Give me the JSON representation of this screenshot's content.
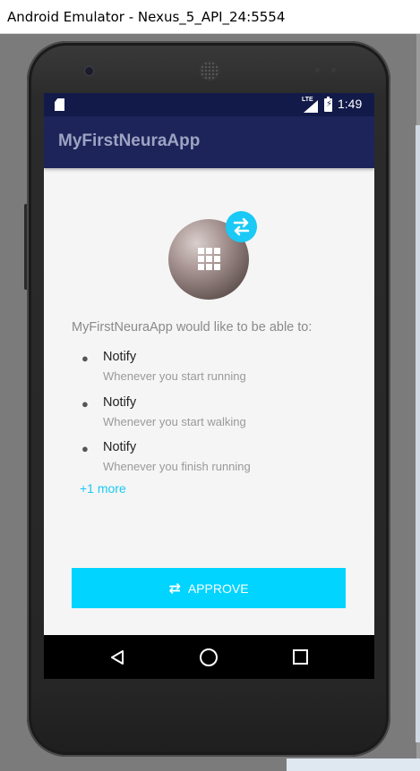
{
  "window": {
    "title": "Android Emulator - Nexus_5_API_24:5554"
  },
  "statusbar": {
    "network": "LTE",
    "time": "1:49"
  },
  "app": {
    "title": "MyFirstNeuraApp"
  },
  "permissions": {
    "intro": "MyFirstNeuraApp would like to be able to:",
    "items": [
      {
        "title": "Notify",
        "description": "Whenever you start running"
      },
      {
        "title": "Notify",
        "description": "Whenever you start walking"
      },
      {
        "title": "Notify",
        "description": "Whenever you finish running"
      }
    ],
    "more": "+1 more"
  },
  "approve": {
    "label": "APPROVE"
  },
  "colors": {
    "accent": "#00d4ff",
    "appbar": "#1c2459",
    "statusbar": "#121a49"
  },
  "icons": [
    "sd-card-icon",
    "lte-signal-icon",
    "battery-charging-icon",
    "app-grid-icon",
    "swap-arrows-icon",
    "back-icon",
    "home-icon",
    "recents-icon"
  ]
}
